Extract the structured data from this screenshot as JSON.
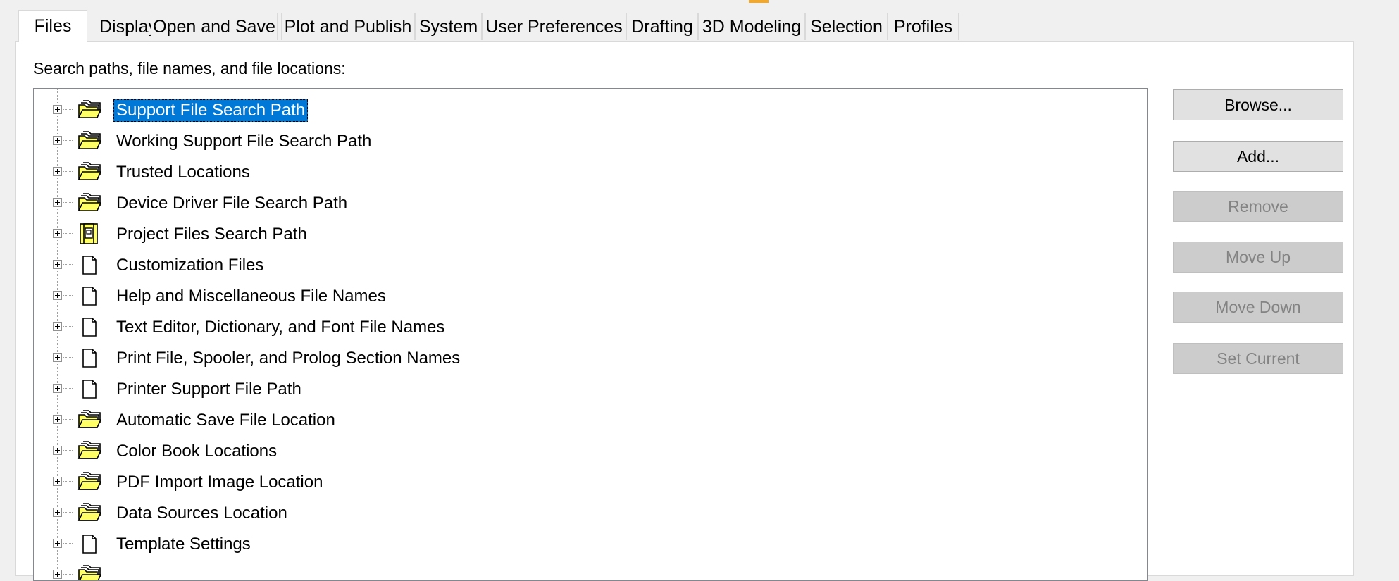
{
  "tabs": [
    {
      "label": "Files",
      "active": true
    },
    {
      "label": "Display"
    },
    {
      "label": "Open and Save"
    },
    {
      "label": "Plot and Publish"
    },
    {
      "label": "System"
    },
    {
      "label": "User Preferences"
    },
    {
      "label": "Drafting"
    },
    {
      "label": "3D Modeling"
    },
    {
      "label": "Selection"
    },
    {
      "label": "Profiles"
    }
  ],
  "files_panel": {
    "caption": "Search paths, file names, and file locations:",
    "tree_items": [
      {
        "label": "Support File Search Path",
        "icon": "folder-stack-icon",
        "selected": true
      },
      {
        "label": "Working Support File Search Path",
        "icon": "folder-stack-icon"
      },
      {
        "label": "Trusted Locations",
        "icon": "folder-stack-icon"
      },
      {
        "label": "Device Driver File Search Path",
        "icon": "folder-stack-icon"
      },
      {
        "label": "Project Files Search Path",
        "icon": "project-files-icon"
      },
      {
        "label": "Customization Files",
        "icon": "document-icon"
      },
      {
        "label": "Help and Miscellaneous File Names",
        "icon": "document-icon"
      },
      {
        "label": "Text Editor, Dictionary, and Font File Names",
        "icon": "document-icon"
      },
      {
        "label": "Print File, Spooler, and Prolog Section Names",
        "icon": "document-icon"
      },
      {
        "label": "Printer Support File Path",
        "icon": "document-icon"
      },
      {
        "label": "Automatic Save File Location",
        "icon": "folder-stack-icon"
      },
      {
        "label": "Color Book Locations",
        "icon": "folder-stack-icon"
      },
      {
        "label": "PDF Import Image Location",
        "icon": "folder-stack-icon"
      },
      {
        "label": "Data Sources Location",
        "icon": "folder-stack-icon"
      },
      {
        "label": "Template Settings",
        "icon": "document-icon"
      },
      {
        "label": "",
        "icon": "folder-stack-icon"
      }
    ],
    "buttons": {
      "browse": "Browse...",
      "add": "Add...",
      "remove": "Remove",
      "move_up": "Move Up",
      "move_down": "Move Down",
      "set_current": "Set Current"
    }
  },
  "colors": {
    "selection": "#0078d7",
    "folder_yellow": "#ffff66",
    "tab_accent": "#f0a830"
  }
}
